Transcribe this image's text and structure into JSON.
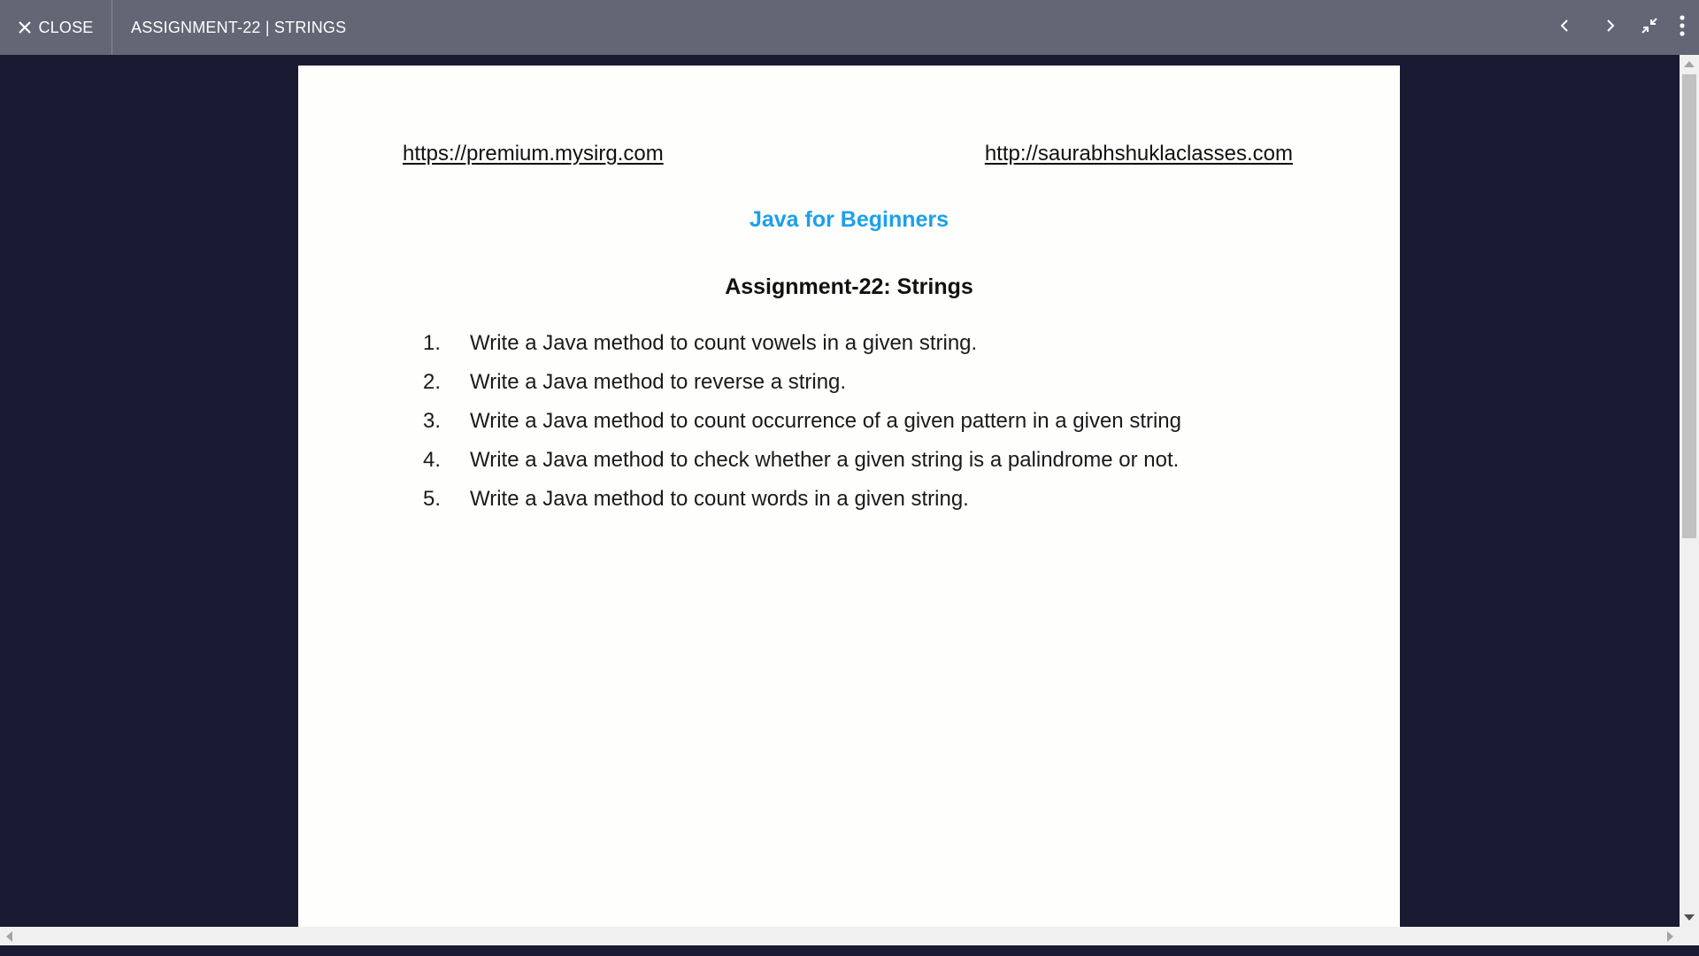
{
  "topbar": {
    "close_label": "CLOSE",
    "title": "ASSIGNMENT-22 | STRINGS",
    "icons": [
      "close-icon",
      "chevron-left-icon",
      "chevron-right-icon",
      "exit-fullscreen-icon",
      "more-vertical-icon"
    ]
  },
  "document": {
    "link_left": "https://premium.mysirg.com",
    "link_right": "http://saurabhshuklaclasses.com",
    "course_title": "Java for Beginners",
    "assignment_title": "Assignment-22: Strings",
    "questions": [
      {
        "num": "1.",
        "text": "Write a Java method to count vowels in a given string."
      },
      {
        "num": "2.",
        "text": "Write a Java method to reverse a string."
      },
      {
        "num": "3.",
        "text": "Write a Java method to count occurrence of a given pattern in a given string"
      },
      {
        "num": "4.",
        "text": "Write a Java method to check whether a given string is a palindrome or not."
      },
      {
        "num": "5.",
        "text": "Write a Java method to count words in a given string."
      }
    ]
  },
  "colors": {
    "topbar_bg": "#636674",
    "viewer_bg": "#191b33",
    "course_title": "#1ca0ea",
    "page_bg": "#fefefc"
  }
}
